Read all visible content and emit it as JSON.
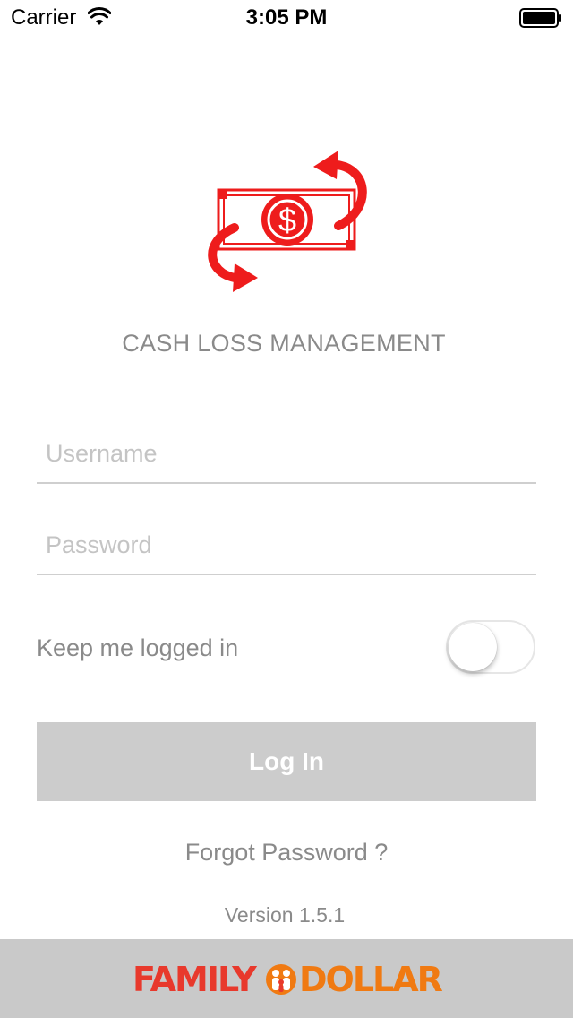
{
  "status_bar": {
    "carrier": "Carrier",
    "time": "3:05 PM",
    "wifi_icon": "wifi-icon",
    "battery_icon": "battery-full-icon"
  },
  "logo": {
    "icon": "cash-exchange-icon",
    "symbol": "$",
    "accent_color": "#ee1c1c"
  },
  "app_title": "CASH LOSS MANAGEMENT",
  "form": {
    "username": {
      "value": "",
      "placeholder": "Username"
    },
    "password": {
      "value": "",
      "placeholder": "Password"
    },
    "keep_logged_in": {
      "label": "Keep me logged in",
      "on": false
    },
    "login_label": "Log In",
    "forgot_label": "Forgot Password ?"
  },
  "version": "Version 1.5.1",
  "footer": {
    "brand_family": "FAMILY",
    "brand_dollar": "DOLLAR",
    "brand_mark_icon": "family-dollar-mark-icon",
    "background": "#c9c9c9",
    "family_color": "#e8392c",
    "dollar_color": "#f07a12"
  },
  "colors": {
    "text_gray": "#8a8a8a",
    "placeholder": "#c4c4c4",
    "button_disabled": "#cccccc",
    "divider": "#cfcfcf"
  }
}
